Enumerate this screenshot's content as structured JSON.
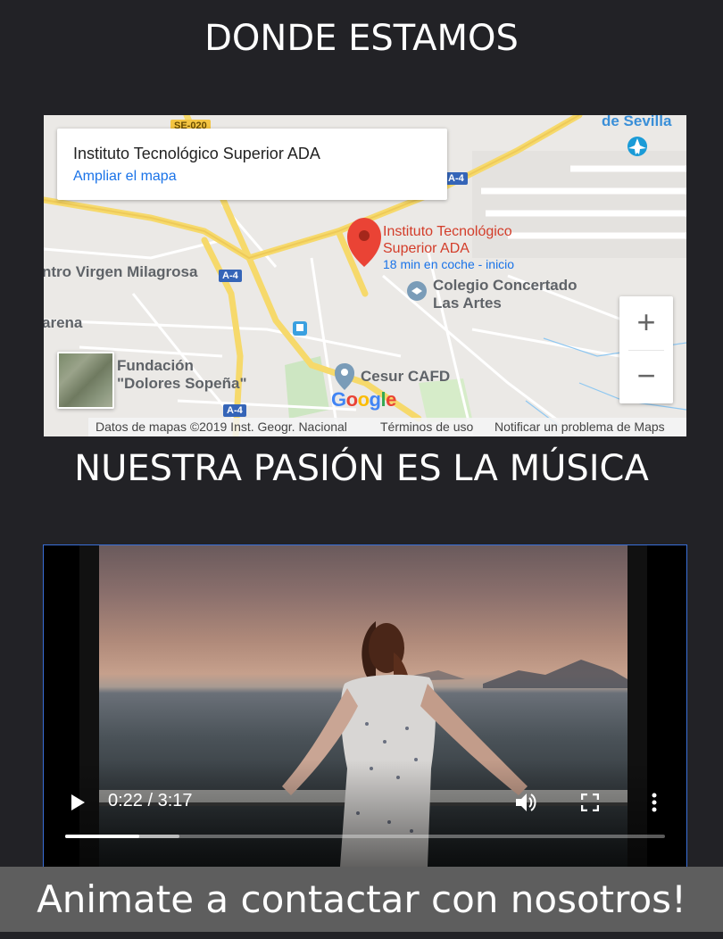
{
  "sections": {
    "location_title": "DONDE ESTAMOS",
    "music_title": "NUESTRA PASIÓN ES LA MÚSICA"
  },
  "map": {
    "card": {
      "place_name": "Instituto Tecnológico Superior ADA",
      "expand_link": "Ampliar el mapa"
    },
    "pin": {
      "label_line1": "Instituto Tecnológico",
      "label_line2": "Superior ADA",
      "sublabel": "18 min en coche - inicio",
      "color": "#d33d2a"
    },
    "places": {
      "sevilla": "de Sevilla",
      "virgen": "ntro Virgen Milagrosa",
      "arena": "arena",
      "colegio_line1": "Colegio Concertado",
      "colegio_line2": "Las Artes",
      "fundacion_line1": "Fundación",
      "fundacion_line2": "\"Dolores Sopeña\"",
      "cesur": "Cesur CAFD",
      "nt": "Nt"
    },
    "routes": {
      "se020": "SE-020",
      "a4_top": "A-4",
      "a4_left": "A-4",
      "a4_bottom": "A-4"
    },
    "zoom": {
      "in": "+",
      "out": "−"
    },
    "google_logo": [
      "G",
      "o",
      "o",
      "g",
      "l",
      "e"
    ],
    "google_colors": [
      "#4285f4",
      "#ea4335",
      "#fbbc05",
      "#4285f4",
      "#34a853",
      "#ea4335"
    ],
    "attribution": {
      "data": "Datos de mapas ©2019 Inst. Geogr. Nacional",
      "terms": "Términos de uso",
      "report": "Notificar un problema de Maps"
    }
  },
  "video": {
    "time_display": "0:22 / 3:17",
    "played_fraction": 0.123,
    "buffered_fraction": 0.19,
    "icons": [
      "play-icon",
      "volume-icon",
      "fullscreen-icon",
      "more-options-icon"
    ]
  },
  "cta": {
    "label": "Animate a contactar con nosotros!"
  },
  "colors": {
    "background": "#222226",
    "cta_background": "#5e5e5e",
    "link_blue": "#1a73e8",
    "route_blue": "#3565b8",
    "video_border": "#3a6fd8"
  }
}
